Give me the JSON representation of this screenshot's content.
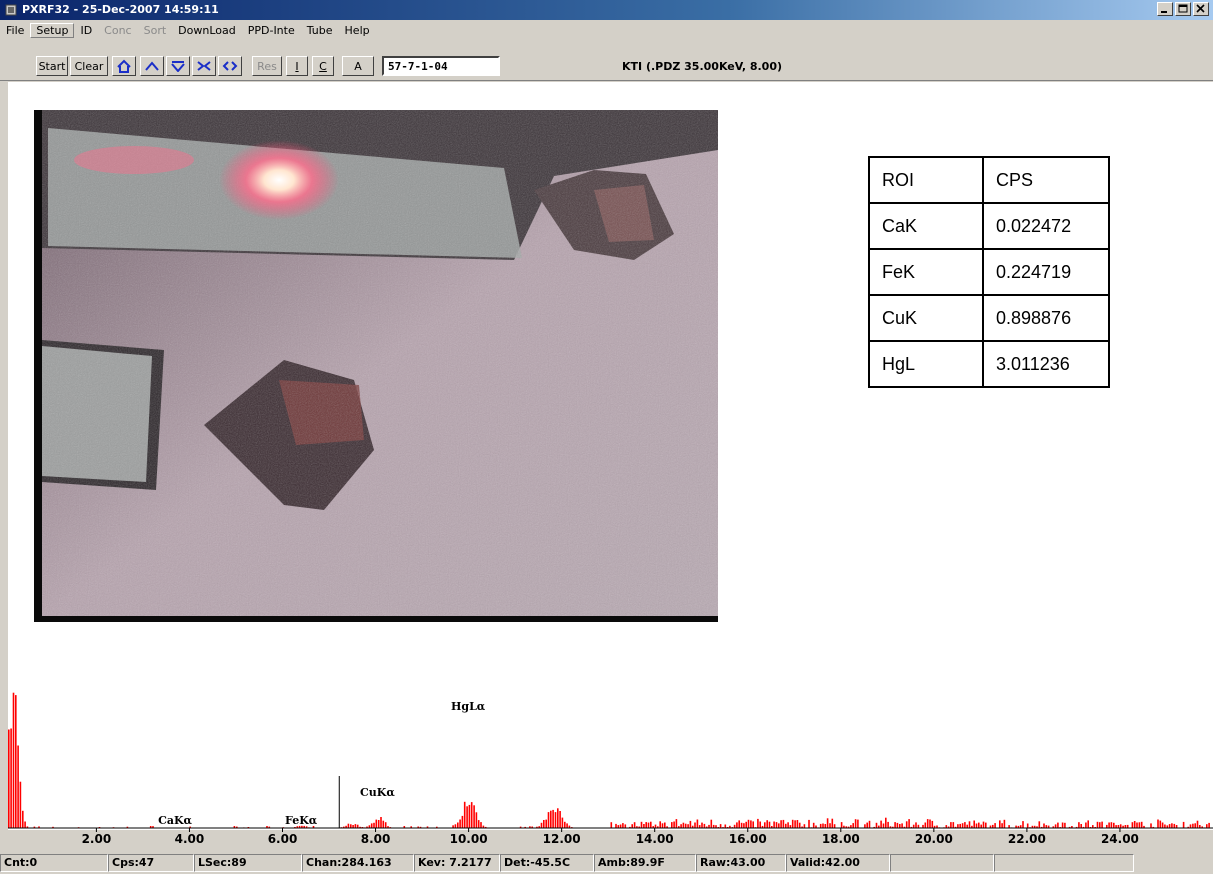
{
  "window": {
    "title": "PXRF32 - 25-Dec-2007 14:59:11"
  },
  "menu": [
    {
      "label": "File",
      "state": "normal"
    },
    {
      "label": "Setup",
      "state": "active"
    },
    {
      "label": "ID",
      "state": "normal"
    },
    {
      "label": "Conc",
      "state": "disabled"
    },
    {
      "label": "Sort",
      "state": "disabled"
    },
    {
      "label": "DownLoad",
      "state": "normal"
    },
    {
      "label": "PPD-Inte",
      "state": "normal"
    },
    {
      "label": "Tube",
      "state": "normal"
    },
    {
      "label": "Help",
      "state": "normal"
    }
  ],
  "toolbar": {
    "start_label": "Start",
    "clear_label": "Clear",
    "res_label": "Res",
    "i_label": "I",
    "c_label": "C",
    "a_label": "A",
    "sample_id": "57-7-1-04",
    "header": "KTI  (.PDZ 35.00KeV, 8.00)"
  },
  "roi_table": {
    "header": [
      "ROI",
      "CPS"
    ],
    "rows": [
      [
        "CaK",
        "0.022472"
      ],
      [
        "FeK",
        "0.224719"
      ],
      [
        "CuK",
        "0.898876"
      ],
      [
        "HgL",
        "3.011236"
      ]
    ]
  },
  "status_bar": [
    "Cnt:0",
    "Cps:47",
    "LSec:89",
    "Chan:284.163",
    "Kev: 7.2177",
    "Det:-45.5C",
    "Amb:89.9F",
    "Raw:43.00",
    "Valid:42.00",
    "",
    ""
  ],
  "chart_data": {
    "type": "bar",
    "title": "",
    "xlabel": "",
    "ylabel": "",
    "xlim": [
      0.1,
      26.0
    ],
    "x_ticks": [
      "2.00",
      "4.00",
      "6.00",
      "8.00",
      "10.00",
      "12.00",
      "14.00",
      "16.00",
      "18.00",
      "20.00",
      "22.00",
      "24.00"
    ],
    "marker_kev": 7.22,
    "peak_labels": [
      {
        "text": "CaKα",
        "kev": 3.69
      },
      {
        "text": "FeKα",
        "kev": 6.4
      },
      {
        "text": "CuKα",
        "kev": 8.04
      },
      {
        "text": "HgLα",
        "kev": 9.99
      }
    ],
    "peaks": [
      {
        "kev": 0.2,
        "height": 100,
        "width": 0.1
      },
      {
        "kev": 8.04,
        "height": 7,
        "width": 0.12
      },
      {
        "kev": 9.99,
        "height": 20,
        "width": 0.14
      },
      {
        "kev": 11.82,
        "height": 16,
        "width": 0.15
      },
      {
        "kev": 7.48,
        "height": 3,
        "width": 0.12
      },
      {
        "kev": 6.4,
        "height": 2,
        "width": 0.1
      }
    ],
    "baseline": [
      {
        "kev": 14,
        "height": 2
      },
      {
        "kev": 20,
        "height": 3
      },
      {
        "kev": 26,
        "height": 2.5
      }
    ],
    "ylim": [
      0,
      100
    ]
  }
}
